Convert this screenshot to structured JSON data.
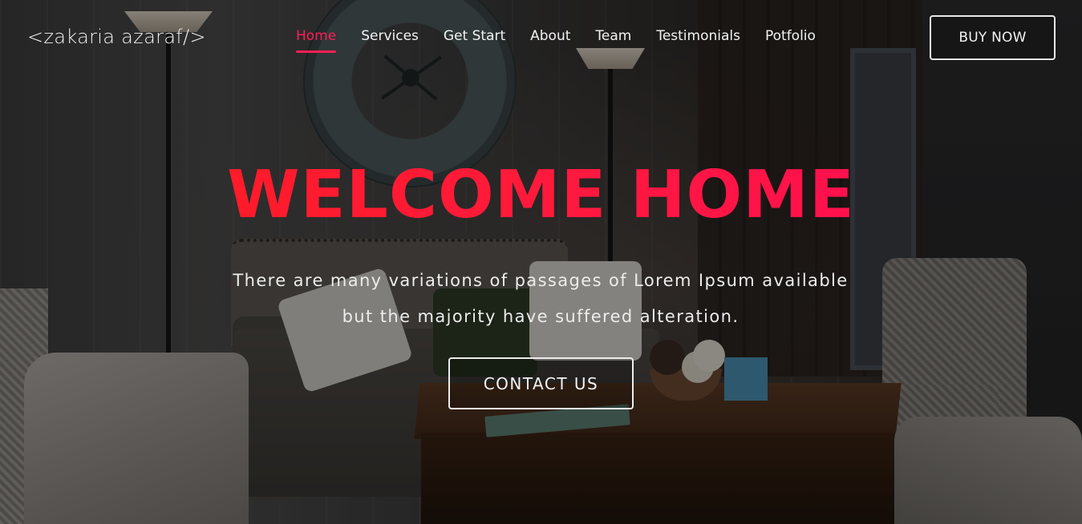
{
  "brand": {
    "logo_text": "<zakaria azaraf/>"
  },
  "nav": {
    "items": [
      {
        "label": "Home",
        "active": true
      },
      {
        "label": "Services",
        "active": false
      },
      {
        "label": "Get Start",
        "active": false
      },
      {
        "label": "About",
        "active": false
      },
      {
        "label": "Team",
        "active": false
      },
      {
        "label": "Testimonials",
        "active": false
      },
      {
        "label": "Potfolio",
        "active": false
      }
    ],
    "buy_label": "BUY NOW"
  },
  "hero": {
    "headline": "WELCOME HOME",
    "subtitle_line1": "There are many variations of passages of Lorem Ipsum available",
    "subtitle_line2": "but the majority have suffered alteration.",
    "cta_label": "CONTACT US"
  },
  "colors": {
    "accent": "#ff1e56",
    "headline_gradient_start": "#ff1c1c",
    "headline_gradient_end": "#ff0a5a",
    "text": "#f2f2f2"
  }
}
